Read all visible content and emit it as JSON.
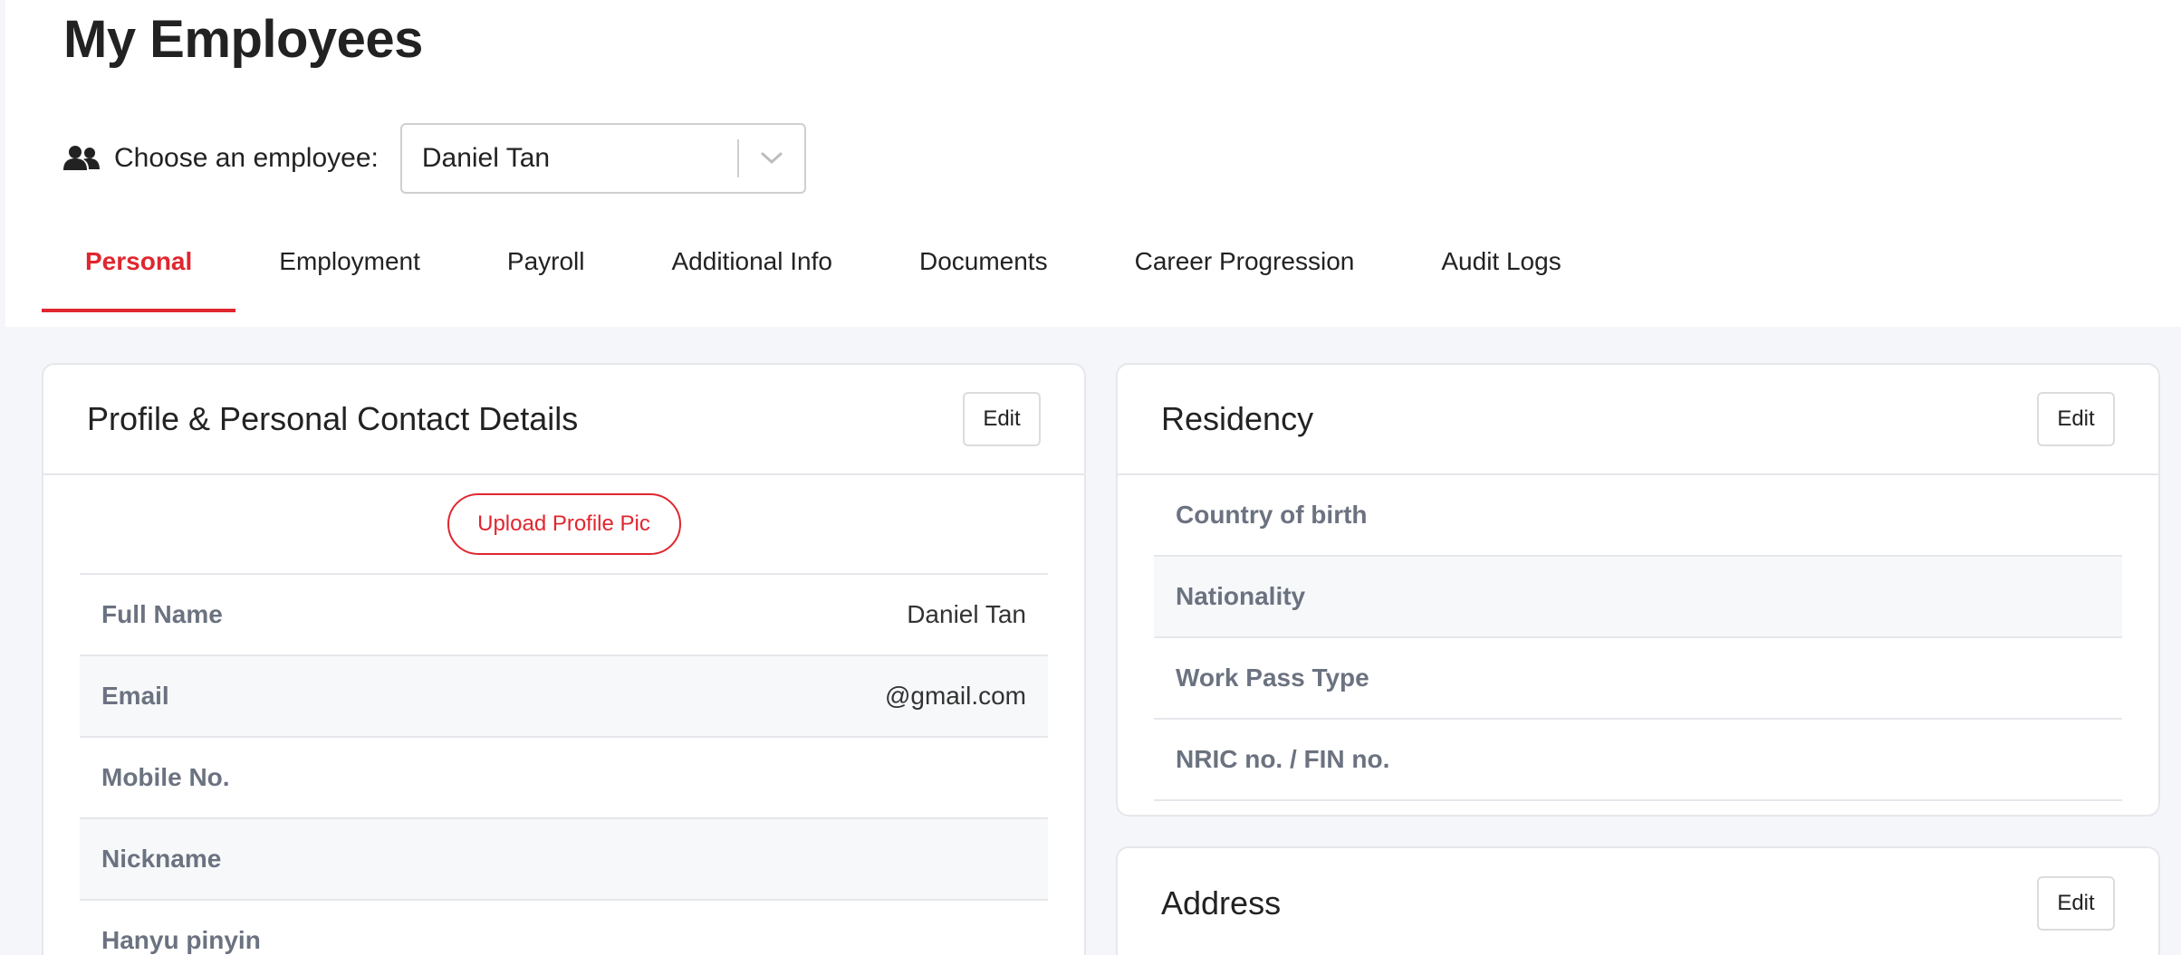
{
  "header": {
    "title": "My Employees",
    "chooser_label": "Choose an employee:",
    "selected_employee": "Daniel Tan"
  },
  "tabs": [
    {
      "label": "Personal",
      "active": true
    },
    {
      "label": "Employment",
      "active": false
    },
    {
      "label": "Payroll",
      "active": false
    },
    {
      "label": "Additional Info",
      "active": false
    },
    {
      "label": "Documents",
      "active": false
    },
    {
      "label": "Career Progression",
      "active": false
    },
    {
      "label": "Audit Logs",
      "active": false
    }
  ],
  "profile_card": {
    "title": "Profile & Personal Contact Details",
    "edit_label": "Edit",
    "upload_label": "Upload Profile Pic",
    "rows": [
      {
        "label": "Full Name",
        "value": "Daniel Tan"
      },
      {
        "label": "Email",
        "value": "@gmail.com"
      },
      {
        "label": "Mobile No.",
        "value": ""
      },
      {
        "label": "Nickname",
        "value": ""
      },
      {
        "label": "Hanyu pinyin",
        "value": ""
      }
    ]
  },
  "residency_card": {
    "title": "Residency",
    "edit_label": "Edit",
    "rows": [
      {
        "label": "Country of birth",
        "value": ""
      },
      {
        "label": "Nationality",
        "value": ""
      },
      {
        "label": "Work Pass Type",
        "value": ""
      },
      {
        "label": "NRIC no. / FIN no.",
        "value": ""
      }
    ]
  },
  "address_card": {
    "title": "Address",
    "edit_label": "Edit"
  },
  "colors": {
    "accent": "#e0262f",
    "label_gray": "#6b7280",
    "page_bg": "#f5f6fa"
  },
  "icons": {
    "chooser": "people-icon",
    "select": "chevron-down-icon"
  }
}
